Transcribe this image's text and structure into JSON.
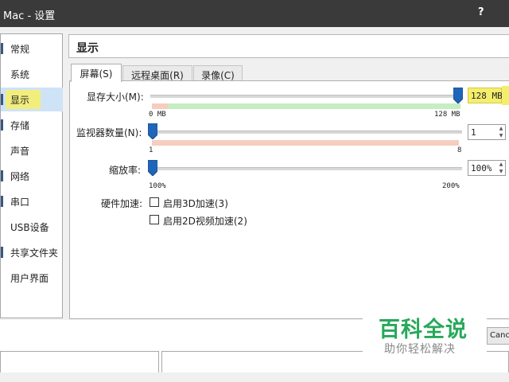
{
  "window": {
    "title": "Mac - 设置",
    "help": "?"
  },
  "sidebar": {
    "items": [
      {
        "label": "常规"
      },
      {
        "label": "系统"
      },
      {
        "label": "显示",
        "selected": true
      },
      {
        "label": "存储"
      },
      {
        "label": "声音"
      },
      {
        "label": "网络"
      },
      {
        "label": "串口"
      },
      {
        "label": "USB设备"
      },
      {
        "label": "共享文件夹"
      },
      {
        "label": "用户界面"
      }
    ]
  },
  "header": {
    "title": "显示"
  },
  "tabs": [
    {
      "label": "屏幕(S)",
      "active": true
    },
    {
      "label": "远程桌面(R)",
      "active": false
    },
    {
      "label": "录像(C)",
      "active": false
    }
  ],
  "screen": {
    "video_memory": {
      "label": "显存大小(M):",
      "min_label": "0 MB",
      "max_label": "128 MB",
      "value_text": "128 MB",
      "value": 128,
      "min": 0,
      "max": 128
    },
    "monitors": {
      "label": "监视器数量(N):",
      "min_label": "1",
      "max_label": "8",
      "value_text": "1",
      "value": 1,
      "min": 1,
      "max": 8
    },
    "scale": {
      "label": "缩放率:",
      "min_label": "100%",
      "max_label": "200%",
      "value_text": "100%",
      "value": 100,
      "min": 100,
      "max": 200
    },
    "acceleration": {
      "label": "硬件加速:",
      "options": [
        {
          "label": "启用3D加速(3)",
          "checked": false
        },
        {
          "label": "启用2D视频加速(2)",
          "checked": false
        }
      ]
    }
  },
  "buttons": {
    "cancel": "Cancel"
  },
  "watermark": {
    "brand": "百科全说",
    "slogan": "助你轻松解决"
  },
  "colors": {
    "accent": "#1f66b8",
    "highlight": "#f1ee7e",
    "ok_range": "#c6eec2",
    "warn_range": "#f6cdbf",
    "watermark": "#28a85a"
  }
}
